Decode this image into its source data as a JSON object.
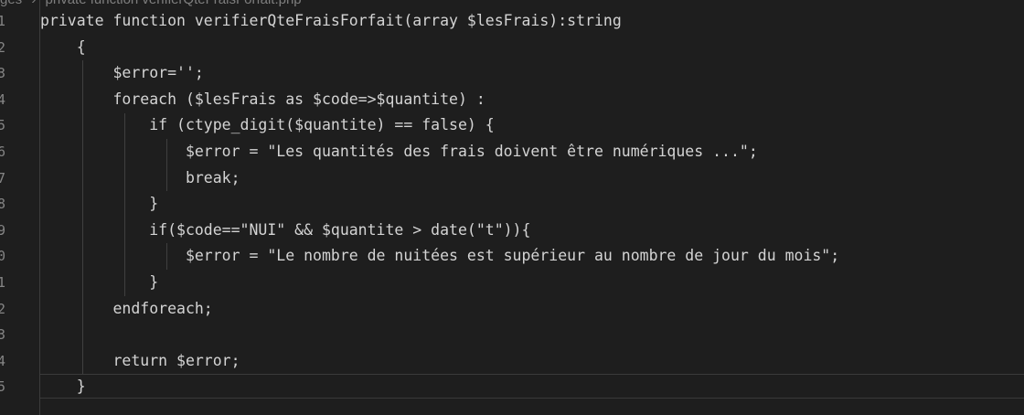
{
  "breadcrumb": {
    "parts": [
      "ges",
      "›",
      "private function verifierQteFraisForfait.php"
    ]
  },
  "gutter": {
    "line_numbers": [
      "1",
      "2",
      "3",
      "4",
      "5",
      "6",
      "7",
      "8",
      "9",
      "0",
      "1",
      "2",
      "3",
      "4",
      "5"
    ]
  },
  "code": {
    "lines": [
      "private function verifierQteFraisForfait(array $lesFrais):string",
      "    {",
      "        $error='';",
      "        foreach ($lesFrais as $code=>$quantite) :",
      "            if (ctype_digit($quantite) == false) {",
      "                $error = \"Les quantités des frais doivent être numériques ...\";",
      "                break;",
      "            }",
      "            if($code==\"NUI\" && $quantite > date(\"t\")){",
      "                $error = \"Le nombre de nuitées est supérieur au nombre de jour du mois\";",
      "            }",
      "        endforeach;",
      "",
      "        return $error;",
      "    }"
    ]
  },
  "colors": {
    "background": "#1e1e1e",
    "text": "#d4d4d4",
    "line_number": "#858585",
    "indent_guide": "#404040"
  }
}
